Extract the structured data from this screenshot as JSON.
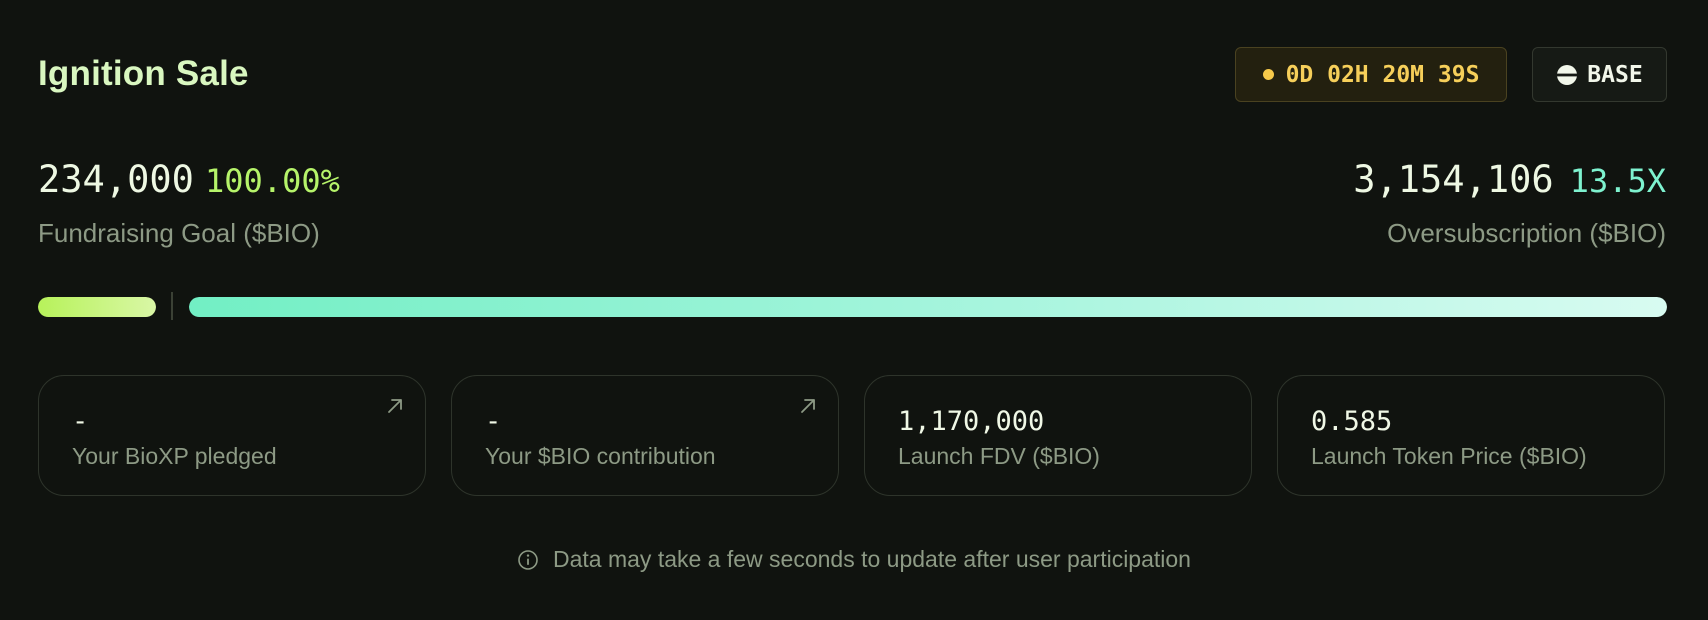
{
  "sale": {
    "title": "Ignition Sale",
    "countdown": "0D 02H 20M 39S",
    "network": "BASE"
  },
  "fundraising": {
    "goal_value": "234,000",
    "goal_percent": "100.00%",
    "goal_fill_fraction": 1.0,
    "goal_label": "Fundraising Goal ($BIO)",
    "oversub_value": "3,154,106",
    "oversub_multiplier": "13.5X",
    "oversub_label": "Oversubscription ($BIO)",
    "oversub_fill_fraction": 1.0
  },
  "cards": [
    {
      "value": "-",
      "label": "Your BioXP pledged",
      "icon": "arrow-up-right-icon"
    },
    {
      "value": "-",
      "label": "Your $BIO contribution",
      "icon": "arrow-up-right-icon"
    },
    {
      "value": "1,170,000",
      "label": "Launch FDV ($BIO)"
    },
    {
      "value": "0.585",
      "label": "Launch Token Price ($BIO)"
    }
  ],
  "note": {
    "text": "Data may take a few seconds to update after user participation",
    "icon": "info-icon"
  },
  "colors": {
    "background": "#10130f",
    "accent_green": "#b6f46a",
    "accent_teal": "#7ef2cf",
    "timer_yellow": "#f6cf5a"
  }
}
